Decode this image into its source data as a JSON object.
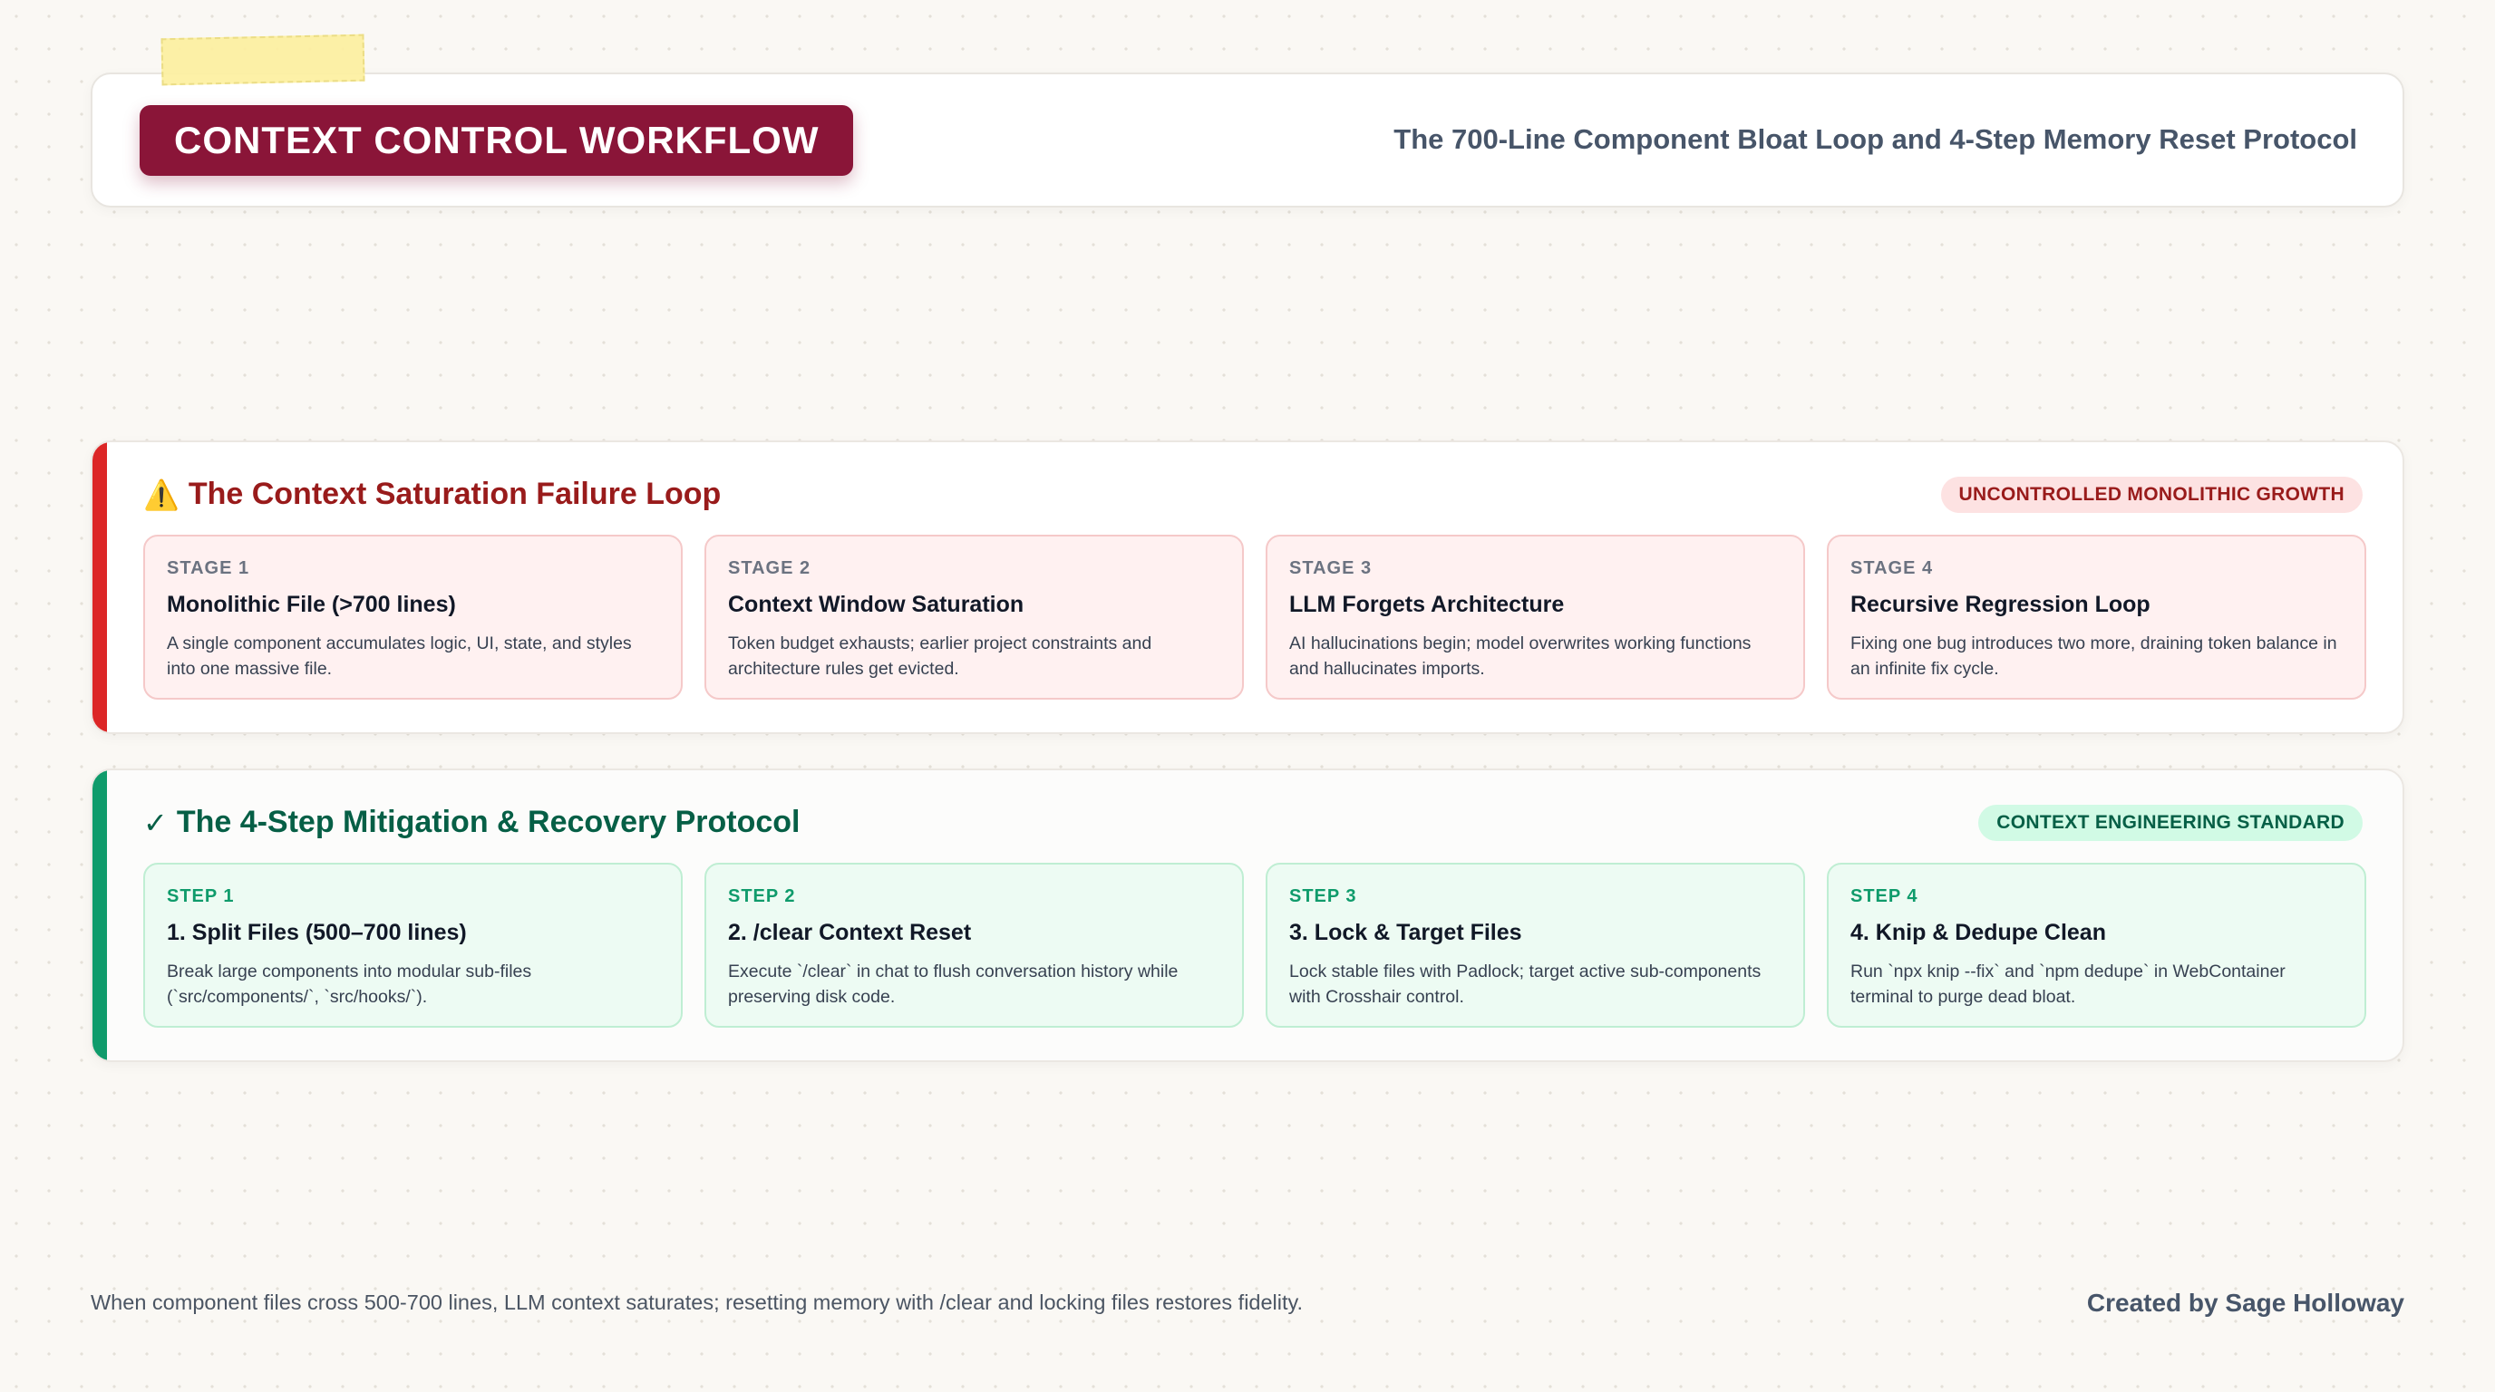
{
  "header": {
    "title": "CONTEXT CONTROL WORKFLOW",
    "subtitle": "The 700-Line Component Bloat Loop and 4-Step Memory Reset Protocol"
  },
  "failure": {
    "icon": "warning-icon",
    "icon_glyph": "⚠️",
    "title": "The Context Saturation Failure Loop",
    "tag": "UNCONTROLLED MONOLITHIC GROWTH",
    "accent_color": "#dc2626",
    "stages": [
      {
        "label": "STAGE 1",
        "title": "Monolithic File (>700 lines)",
        "desc": "A single component accumulates logic, UI, state, and styles into one massive file."
      },
      {
        "label": "STAGE 2",
        "title": "Context Window Saturation",
        "desc": "Token budget exhausts; earlier project constraints and architecture rules get evicted."
      },
      {
        "label": "STAGE 3",
        "title": "LLM Forgets Architecture",
        "desc": "AI hallucinations begin; model overwrites working functions and hallucinates imports."
      },
      {
        "label": "STAGE 4",
        "title": "Recursive Regression Loop",
        "desc": "Fixing one bug introduces two more, draining token balance in an infinite fix cycle."
      }
    ]
  },
  "mitigation": {
    "icon": "checkmark-icon",
    "icon_glyph": "✓",
    "title": "The 4-Step Mitigation & Recovery Protocol",
    "tag": "CONTEXT ENGINEERING STANDARD",
    "accent_color": "#0f9b6b",
    "steps": [
      {
        "label": "STEP 1",
        "title": "1. Split Files (500–700 lines)",
        "desc": "Break large components into modular sub-files (`src/components/`, `src/hooks/`)."
      },
      {
        "label": "STEP 2",
        "title": "2. /clear Context Reset",
        "desc": "Execute `/clear` in chat to flush conversation history while preserving disk code."
      },
      {
        "label": "STEP 3",
        "title": "3. Lock & Target Files",
        "desc": "Lock stable files with Padlock; target active sub-components with Crosshair control."
      },
      {
        "label": "STEP 4",
        "title": "4. Knip & Dedupe Clean",
        "desc": "Run `npx knip --fix` and `npm dedupe` in WebContainer terminal to purge dead bloat."
      }
    ]
  },
  "footer": {
    "note": "When component files cross 500-700 lines, LLM context saturates; resetting memory with /clear and locking files restores fidelity.",
    "credit": "Created by Sage Holloway"
  }
}
